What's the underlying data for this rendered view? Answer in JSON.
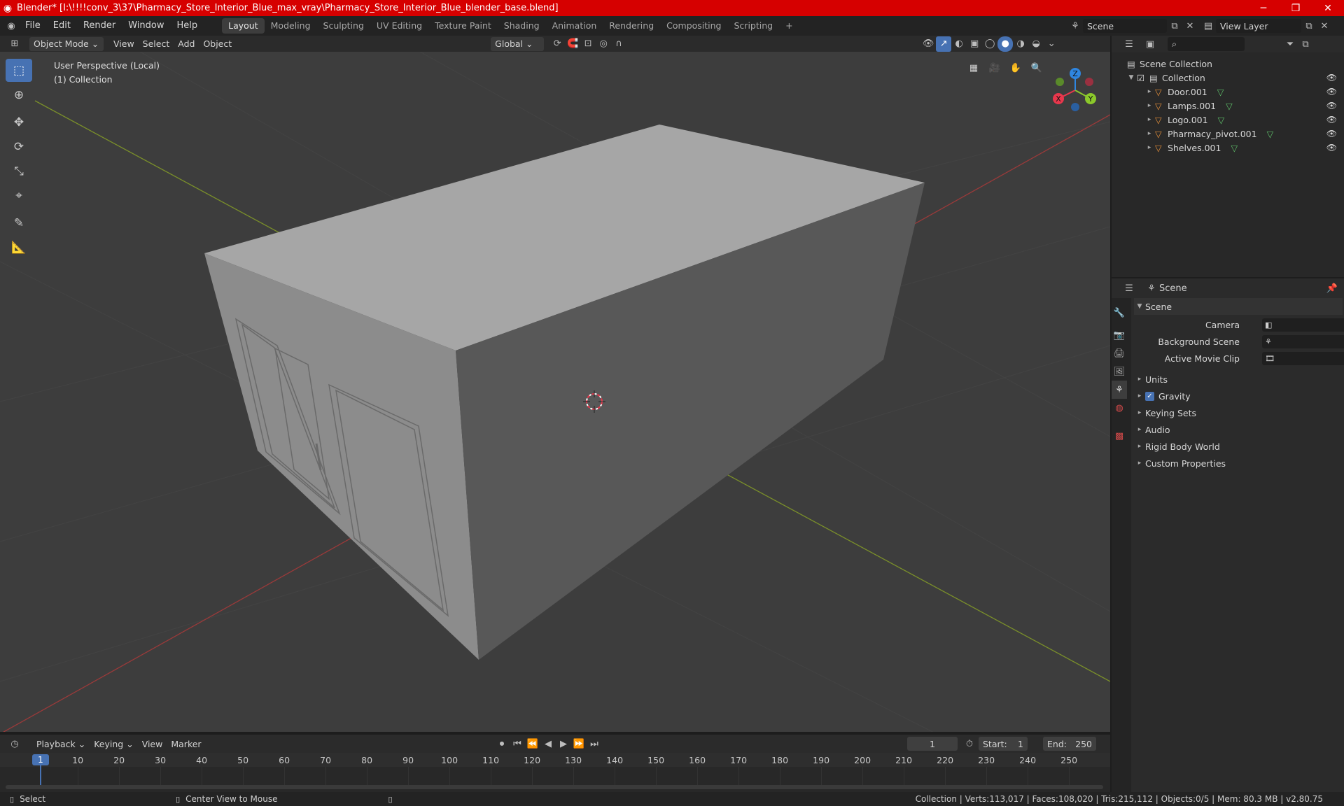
{
  "titlebar": {
    "title": "Blender* [I:\\!!!!conv_3\\37\\Pharmacy_Store_Interior_Blue_max_vray\\Pharmacy_Store_Interior_Blue_blender_base.blend]",
    "minimize": "─",
    "maximize": "❐",
    "close": "✕"
  },
  "menu": {
    "items": [
      "File",
      "Edit",
      "Render",
      "Window",
      "Help"
    ]
  },
  "workspaces": [
    "Layout",
    "Modeling",
    "Sculpting",
    "UV Editing",
    "Texture Paint",
    "Shading",
    "Animation",
    "Rendering",
    "Compositing",
    "Scripting"
  ],
  "workspace_add": "+",
  "scene_selector": {
    "label": "Scene",
    "view_layer": "View Layer"
  },
  "viewport_header": {
    "mode": "Object Mode",
    "view": "View",
    "select": "Select",
    "add": "Add",
    "object": "Object",
    "orientation": "Global"
  },
  "viewport_info": {
    "line1": "User Perspective (Local)",
    "line2": "(1) Collection"
  },
  "gizmo": {
    "x": "X",
    "y": "Y",
    "z": "Z"
  },
  "outliner": {
    "root": "Scene Collection",
    "collection": "Collection",
    "objects": [
      "Door.001",
      "Lamps.001",
      "Logo.001",
      "Pharmacy_pivot.001",
      "Shelves.001"
    ]
  },
  "properties": {
    "context": "Scene",
    "panel": "Scene",
    "camera_label": "Camera",
    "background_label": "Background Scene",
    "movieclip_label": "Active Movie Clip",
    "sections": [
      "Units",
      "Gravity",
      "Keying Sets",
      "Audio",
      "Rigid Body World",
      "Custom Properties"
    ]
  },
  "timeline": {
    "playback": "Playback",
    "keying": "Keying",
    "view": "View",
    "marker": "Marker",
    "current_frame": "1",
    "start_label": "Start:",
    "start": "1",
    "end_label": "End:",
    "end": "250",
    "ticks": [
      "10",
      "20",
      "30",
      "40",
      "50",
      "60",
      "70",
      "80",
      "90",
      "100",
      "110",
      "120",
      "130",
      "140",
      "150",
      "160",
      "170",
      "180",
      "190",
      "200",
      "210",
      "220",
      "230",
      "240",
      "250"
    ],
    "playhead": "1"
  },
  "statusbar": {
    "select": "Select",
    "center": "Center View to Mouse",
    "stats": "Collection | Verts:113,017 | Faces:108,020 | Tris:215,112 | Objects:0/5 | Mem: 80.3 MB | v2.80.75"
  },
  "colors": {
    "title_red": "#d60000",
    "accent_blue": "#4772b3",
    "axis_x": "#e8374c",
    "axis_y": "#8bc82b",
    "axis_z": "#2f86e0"
  }
}
